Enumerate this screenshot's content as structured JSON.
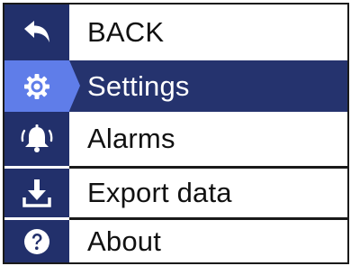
{
  "menu": {
    "items": [
      {
        "label": "BACK",
        "icon": "back-arrow-icon"
      },
      {
        "label": "Settings",
        "icon": "gear-icon",
        "selected": true
      },
      {
        "label": "Alarms",
        "icon": "bell-icon"
      },
      {
        "label": "Export data",
        "icon": "download-icon"
      },
      {
        "label": "About",
        "icon": "question-icon"
      }
    ]
  },
  "colors": {
    "icon_column": "#22306b",
    "selected_icon_bg": "#5f7de9",
    "selected_label_bg": "#25336e",
    "divider": "#1a1a1a"
  }
}
